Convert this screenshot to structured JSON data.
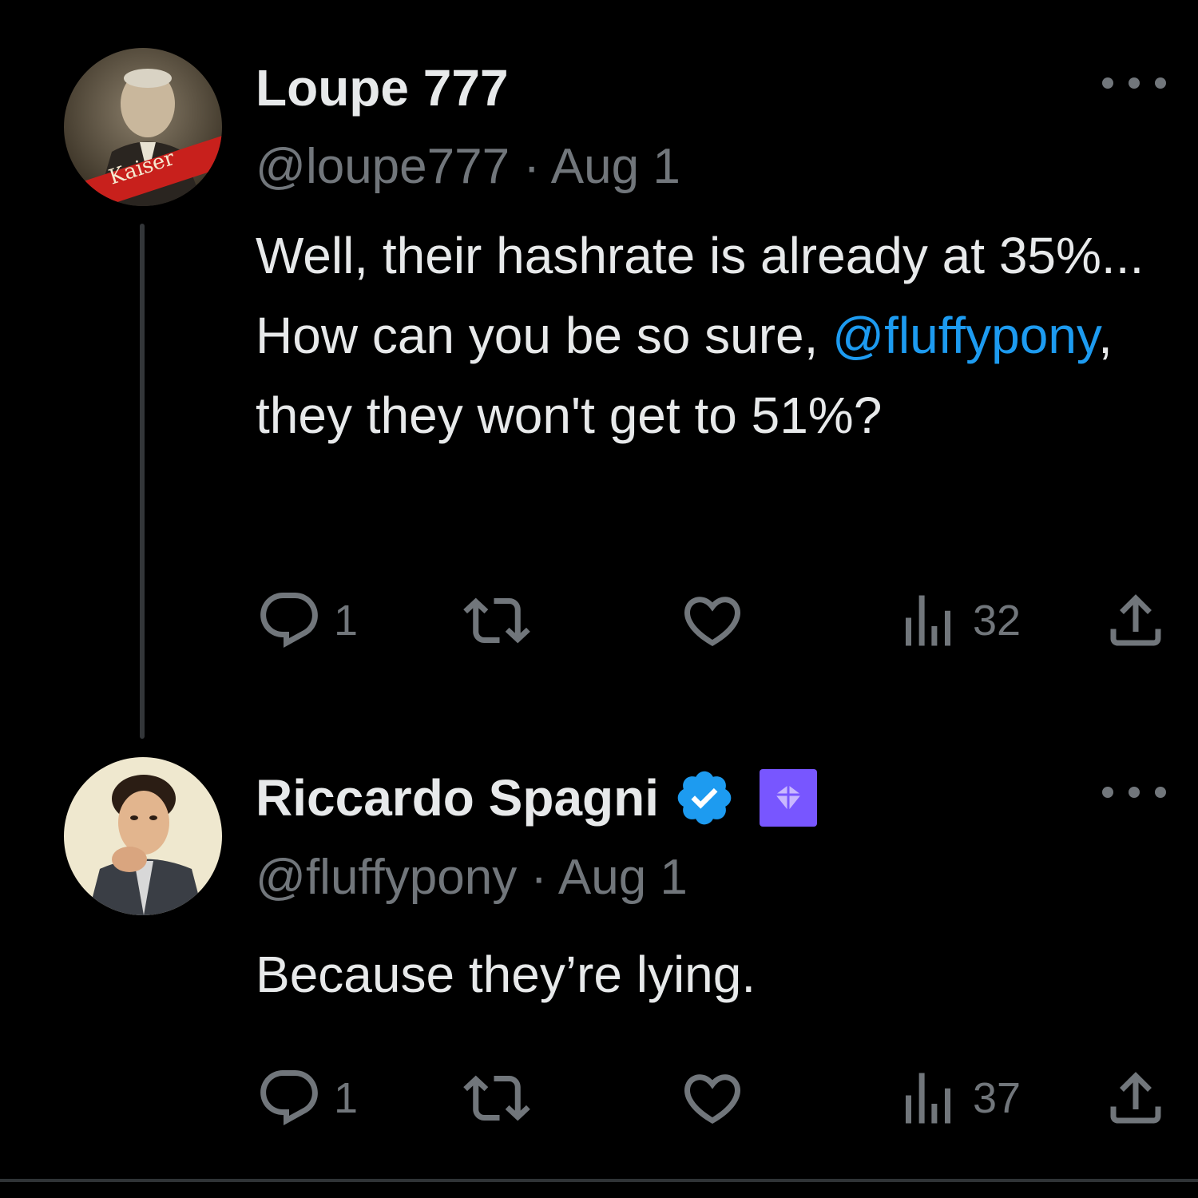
{
  "theme": {
    "background": "#000000",
    "text_primary": "#e7e9ea",
    "text_secondary": "#71767b",
    "link": "#1d9bf0",
    "verified": "#1d9bf0",
    "affiliate_badge": "#7856ff"
  },
  "tweets": [
    {
      "display_name": "Loupe 777",
      "handle": "@loupe777",
      "separator": " · ",
      "date": "Aug 1",
      "text_before_mention": "Well, their hashrate is already at 35%... How can you be so sure, ",
      "mention": "@fluffypony",
      "text_after_mention": ", they they won't get to 51%?",
      "reply_count": "1",
      "repost_count": "",
      "like_count": "",
      "view_count": "32",
      "avatar_icon": "avatar-vintage-portrait",
      "avatar_banner_text": "Kaiser",
      "verified": false
    },
    {
      "display_name": "Riccardo Spagni",
      "handle": "@fluffypony",
      "separator": " · ",
      "date": "Aug 1",
      "text": "Because they’re lying.",
      "reply_count": "1",
      "repost_count": "",
      "like_count": "",
      "view_count": "37",
      "avatar_icon": "avatar-illustrated-portrait",
      "verified": true,
      "badges": [
        "verified-badge-icon",
        "affiliate-badge-icon"
      ]
    }
  ]
}
